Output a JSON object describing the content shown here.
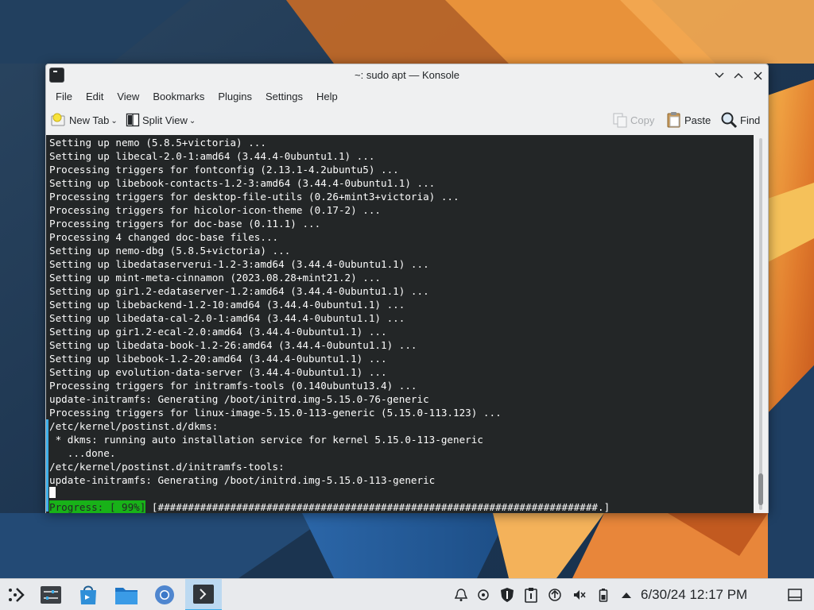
{
  "window": {
    "title": "~: sudo apt — Konsole"
  },
  "menu": [
    "File",
    "Edit",
    "View",
    "Bookmarks",
    "Plugins",
    "Settings",
    "Help"
  ],
  "toolbar": {
    "new_tab": "New Tab",
    "split_view": "Split View",
    "copy": "Copy",
    "paste": "Paste",
    "find": "Find"
  },
  "terminal": {
    "lines": [
      "Setting up nemo (5.8.5+victoria) ...",
      "Setting up libecal-2.0-1:amd64 (3.44.4-0ubuntu1.1) ...",
      "Processing triggers for fontconfig (2.13.1-4.2ubuntu5) ...",
      "Setting up libebook-contacts-1.2-3:amd64 (3.44.4-0ubuntu1.1) ...",
      "Processing triggers for desktop-file-utils (0.26+mint3+victoria) ...",
      "Processing triggers for hicolor-icon-theme (0.17-2) ...",
      "Processing triggers for doc-base (0.11.1) ...",
      "Processing 4 changed doc-base files...",
      "Setting up nemo-dbg (5.8.5+victoria) ...",
      "Setting up libedataserverui-1.2-3:amd64 (3.44.4-0ubuntu1.1) ...",
      "Setting up mint-meta-cinnamon (2023.08.28+mint21.2) ...",
      "Setting up gir1.2-edataserver-1.2:amd64 (3.44.4-0ubuntu1.1) ...",
      "Setting up libebackend-1.2-10:amd64 (3.44.4-0ubuntu1.1) ...",
      "Setting up libedata-cal-2.0-1:amd64 (3.44.4-0ubuntu1.1) ...",
      "Setting up gir1.2-ecal-2.0:amd64 (3.44.4-0ubuntu1.1) ...",
      "Setting up libedata-book-1.2-26:amd64 (3.44.4-0ubuntu1.1) ...",
      "Setting up libebook-1.2-20:amd64 (3.44.4-0ubuntu1.1) ...",
      "Setting up evolution-data-server (3.44.4-0ubuntu1.1) ...",
      "Processing triggers for initramfs-tools (0.140ubuntu13.4) ...",
      "update-initramfs: Generating /boot/initrd.img-5.15.0-76-generic",
      "Processing triggers for linux-image-5.15.0-113-generic (5.15.0-113.123) ...",
      "/etc/kernel/postinst.d/dkms:",
      " * dkms: running auto installation service for kernel 5.15.0-113-generic",
      "   ...done.",
      "/etc/kernel/postinst.d/initramfs-tools:",
      "update-initramfs: Generating /boot/initrd.img-5.15.0-113-generic"
    ],
    "progress_label": "Progress: [ 99%]",
    "progress_bar": " [#########################################################################.]",
    "progress_fraction": 0.99
  },
  "taskbar": {
    "clock": "6/30/24 12:17 PM"
  },
  "colors": {
    "terminal_bg": "#232627",
    "terminal_fg": "#fcfcfc",
    "progress_bg": "#18b218",
    "accent": "#3daee9"
  },
  "icons": {
    "launcher": "application-launcher-icon",
    "settings": "system-settings-icon",
    "discover": "software-store-icon",
    "files": "file-manager-icon",
    "browser": "chromium-icon",
    "konsole": "konsole-icon"
  }
}
